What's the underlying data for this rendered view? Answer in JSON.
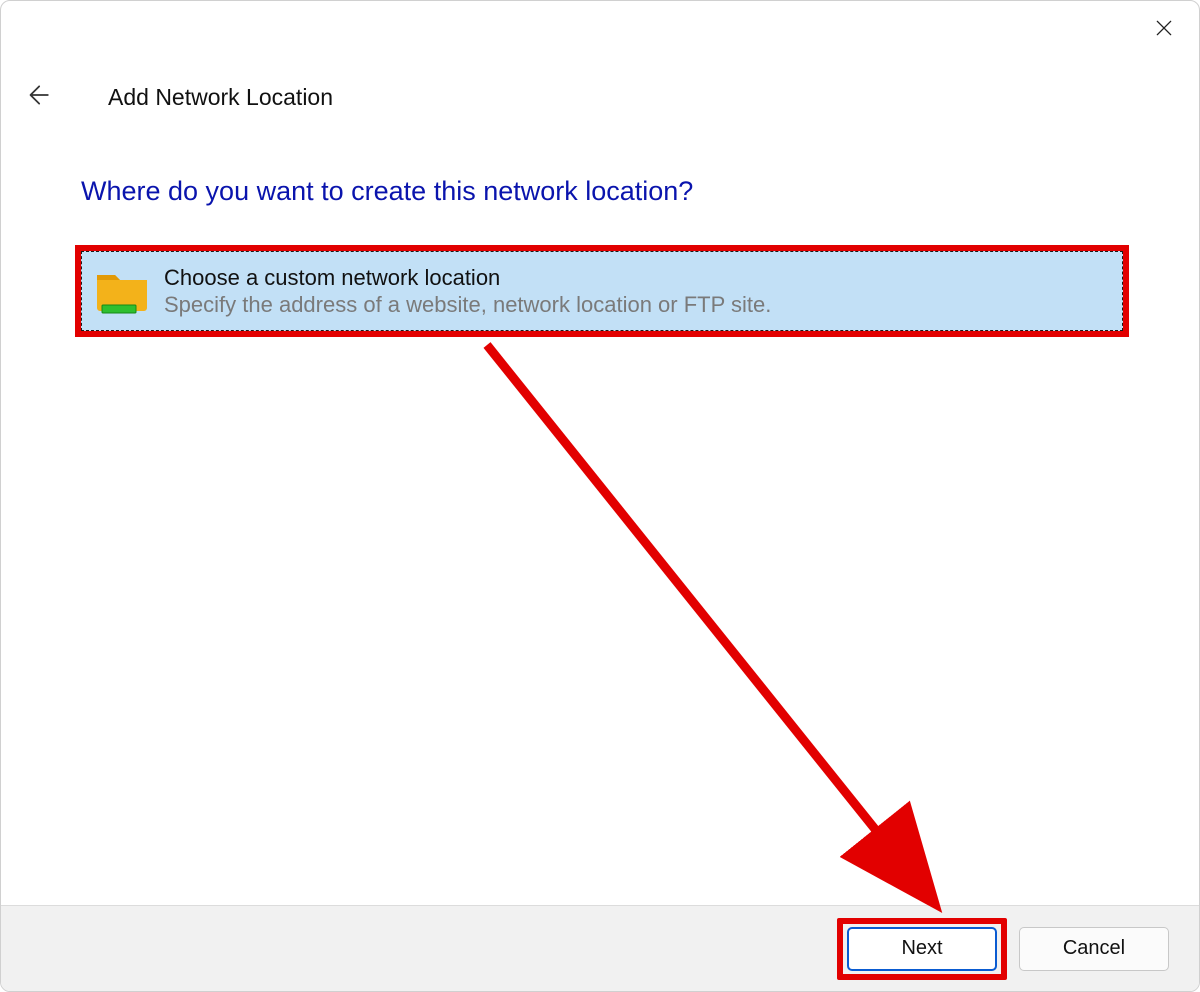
{
  "header": {
    "title": "Add Network Location"
  },
  "heading": "Where do you want to create this network location?",
  "option": {
    "title": "Choose a custom network location",
    "subtitle": "Specify the address of a website, network location or FTP site."
  },
  "footer": {
    "next": "Next",
    "cancel": "Cancel"
  },
  "annotation_color": "#e20000"
}
